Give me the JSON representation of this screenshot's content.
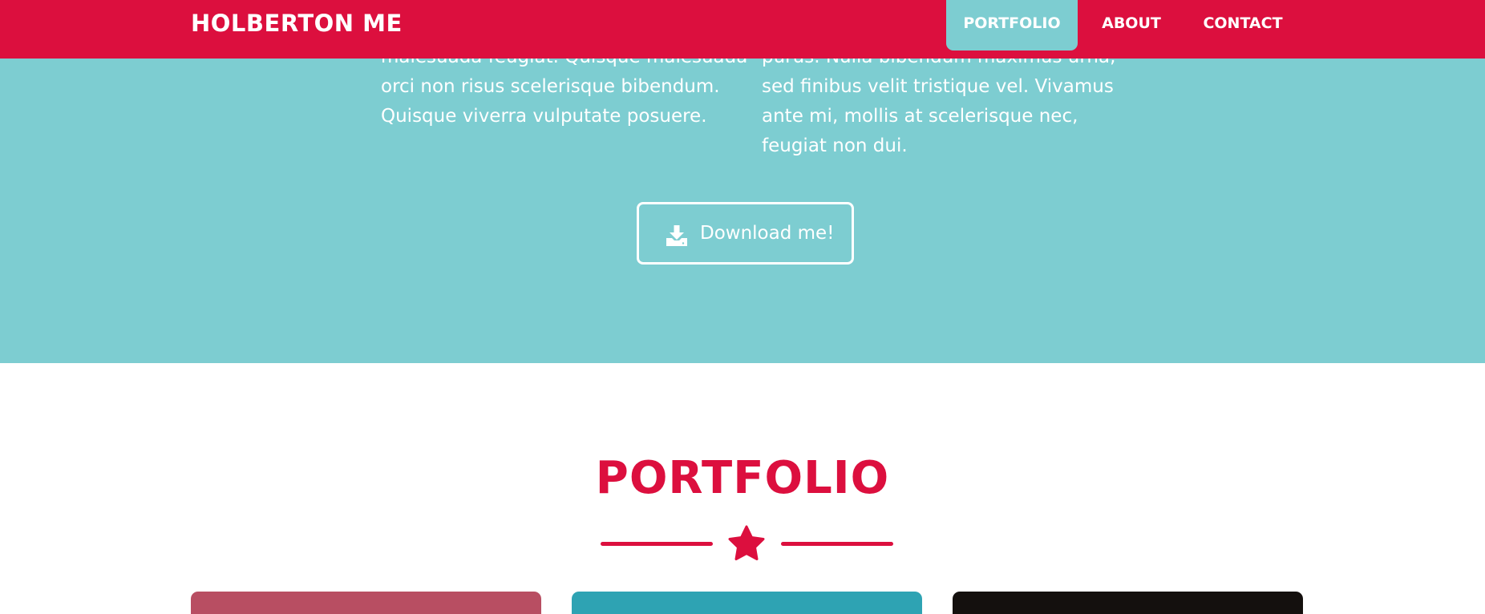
{
  "navbar": {
    "brand": "HOLBERTON ME",
    "items": [
      {
        "label": "PORTFOLIO",
        "active": true
      },
      {
        "label": "ABOUT",
        "active": false
      },
      {
        "label": "CONTACT",
        "active": false
      }
    ]
  },
  "hero": {
    "left_paragraph": [
      "malesuada feugiat. Quisque malesuada",
      "orci non risus scelerisque bibendum.",
      "Quisque viverra vulputate posuere."
    ],
    "right_paragraph": [
      "purus. Nulla bibendum maximus urna,",
      "sed finibus velit tristique vel. Vivamus",
      "ante mi, mollis at scelerisque nec,",
      "feugiat non dui."
    ],
    "download_button": {
      "label": "Download me!",
      "icon": "download-icon"
    }
  },
  "portfolio": {
    "title": "PORTFOLIO",
    "divider_icon": "star-icon",
    "cards": [
      {
        "color": "#b84e62"
      },
      {
        "color": "#2ea3b3"
      },
      {
        "color": "#14100e"
      }
    ]
  },
  "colors": {
    "primary": "#dc0f3e",
    "secondary": "#7dcdd1",
    "text_on_color": "#ffffff"
  }
}
